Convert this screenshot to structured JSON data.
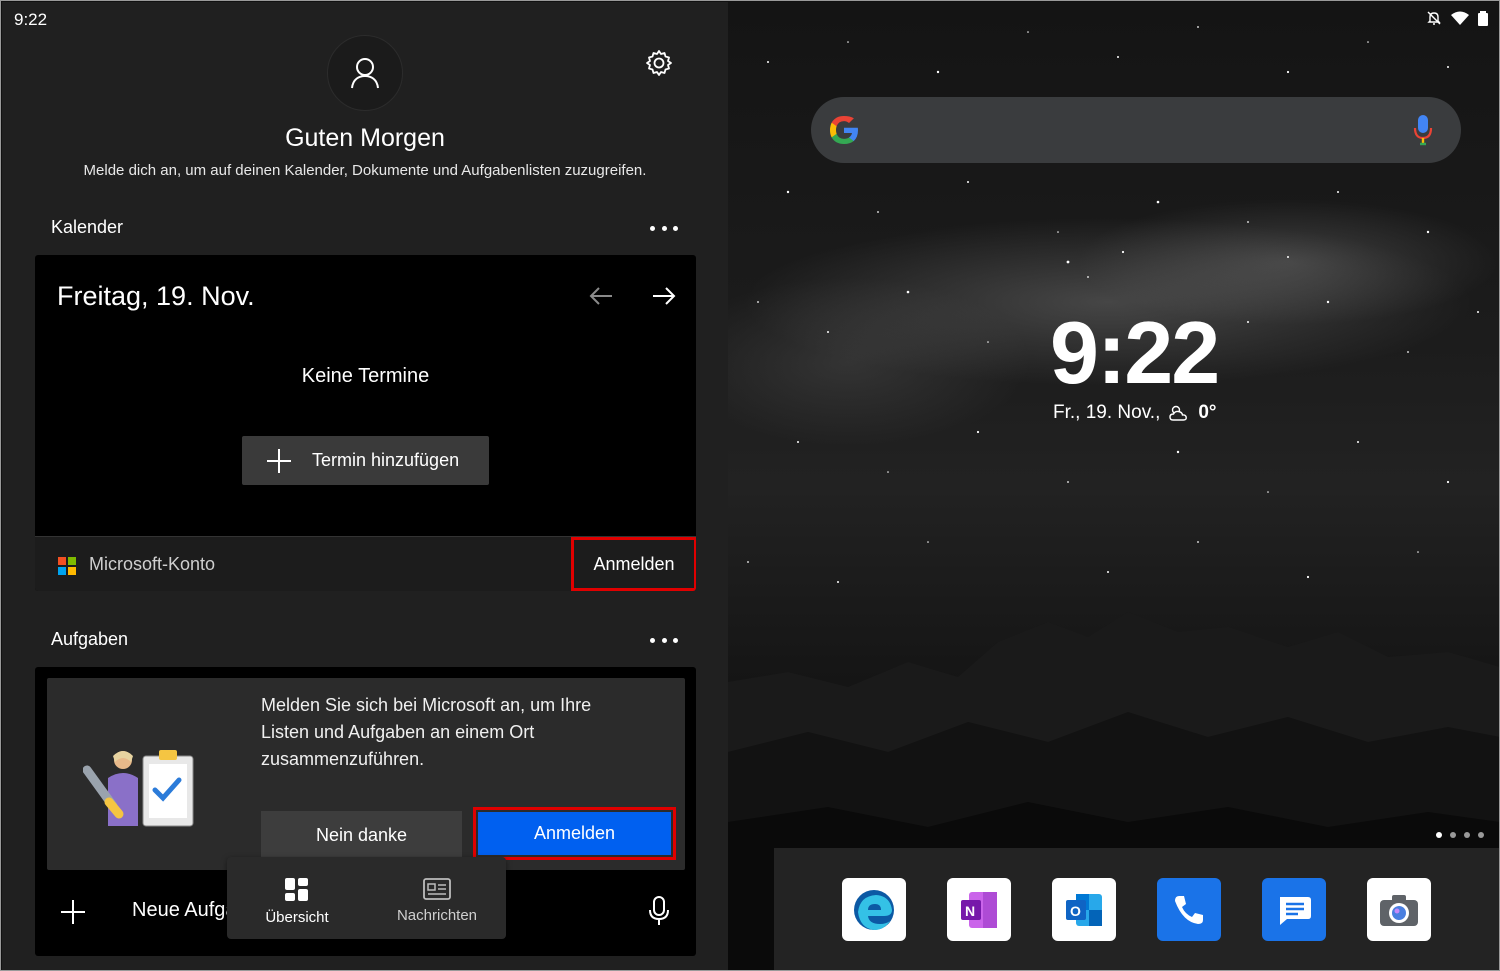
{
  "status_bar": {
    "time": "9:22"
  },
  "header": {
    "greeting": "Guten Morgen",
    "subline": "Melde dich an, um auf deinen Kalender, Dokumente und Aufgabenlisten zuzugreifen."
  },
  "calendar": {
    "section_title": "Kalender",
    "date": "Freitag, 19. Nov.",
    "empty_text": "Keine Termine",
    "add_button": "Termin hinzufügen",
    "account_label": "Microsoft-Konto",
    "signin_label": "Anmelden"
  },
  "tasks": {
    "section_title": "Aufgaben",
    "prompt": "Melden Sie sich bei Microsoft an, um Ihre Listen und Aufgaben an einem Ort zusammenzuführen.",
    "decline_button": "Nein danke",
    "signin_button": "Anmelden",
    "new_task_label": "Neue Aufgabe"
  },
  "bottom_nav": {
    "items": [
      {
        "label": "Übersicht",
        "active": true
      },
      {
        "label": "Nachrichten",
        "active": false
      }
    ]
  },
  "home_screen": {
    "clock": "9:22",
    "date": "Fr., 19. Nov.,",
    "temperature": "0°",
    "dock_apps": [
      "edge-icon",
      "onenote-icon",
      "outlook-icon",
      "phone-icon",
      "messages-icon",
      "camera-icon"
    ]
  },
  "colors": {
    "accent_blue": "#0060f0",
    "highlight_red": "#e00000",
    "panel_bg": "#202020"
  }
}
